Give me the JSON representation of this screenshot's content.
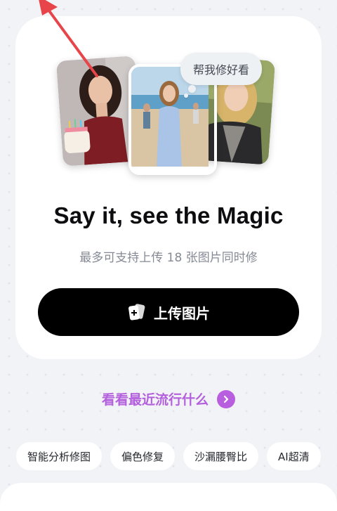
{
  "hero": {
    "bubble_text": "帮我修好看",
    "headline": "Say it, see the Magic",
    "subtitle": "最多可支持上传 18 张图片同时修",
    "upload_label": "上传图片"
  },
  "trending": {
    "label": "看看最近流行什么"
  },
  "chips": [
    {
      "label": "智能分析修图"
    },
    {
      "label": "偏色修复"
    },
    {
      "label": "沙漏腰臀比"
    },
    {
      "label": "AI超清"
    }
  ],
  "colors": {
    "accent_purple": "#b460dc",
    "button_black": "#000000",
    "background": "#f1f3f7",
    "pointer_arrow": "#e8454a"
  },
  "icons": {
    "upload": "add-photo-icon",
    "trending_arrow": "chevron-right-icon",
    "annotation": "red-pointer-arrow-icon"
  }
}
